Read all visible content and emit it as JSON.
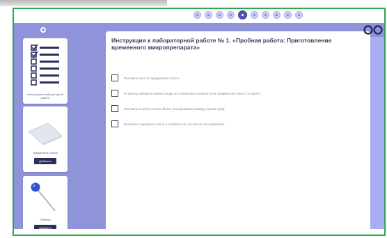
{
  "nav": {
    "tabs": [
      {
        "name": "step-1",
        "active": false
      },
      {
        "name": "step-2",
        "active": false
      },
      {
        "name": "step-3",
        "active": false
      },
      {
        "name": "step-4",
        "active": false
      },
      {
        "name": "step-5",
        "active": true
      },
      {
        "name": "step-6",
        "active": false
      },
      {
        "name": "step-7",
        "active": false
      },
      {
        "name": "step-8",
        "active": false
      },
      {
        "name": "step-9",
        "active": false
      },
      {
        "name": "step-10",
        "active": false
      }
    ]
  },
  "sidebar": {
    "cards": [
      {
        "label": "Инструкция к лабораторной работе",
        "icon": "checklist-icon"
      },
      {
        "label": "Предметное стекло",
        "button": "Добавить",
        "icon": "glass-slide-icon"
      },
      {
        "label": "Пипетка",
        "button": "Добавить",
        "icon": "needle-icon"
      }
    ]
  },
  "instruction": {
    "title": "Инструкция к лабораторной работе № 1. «Пробная работа: Приготовление временного микропрепарата»",
    "steps": [
      "Положите на стол предметное стекло.",
      "В пипетку наберите немного воды из стаканчика и нанесите на предметное стекло 1-2 капли.",
      "Положите в центр стекла объект исследования (кожицу лукови лука).",
      "Возьмите покровное стекло и положите его на объект исследования."
    ]
  },
  "colors": {
    "accent": "#4a55b8",
    "frame_border": "#2ca84a",
    "sidebar_bg": "#8e93da",
    "workspace_bg": "#a8aef2",
    "button_bg": "#2b2f5c"
  }
}
